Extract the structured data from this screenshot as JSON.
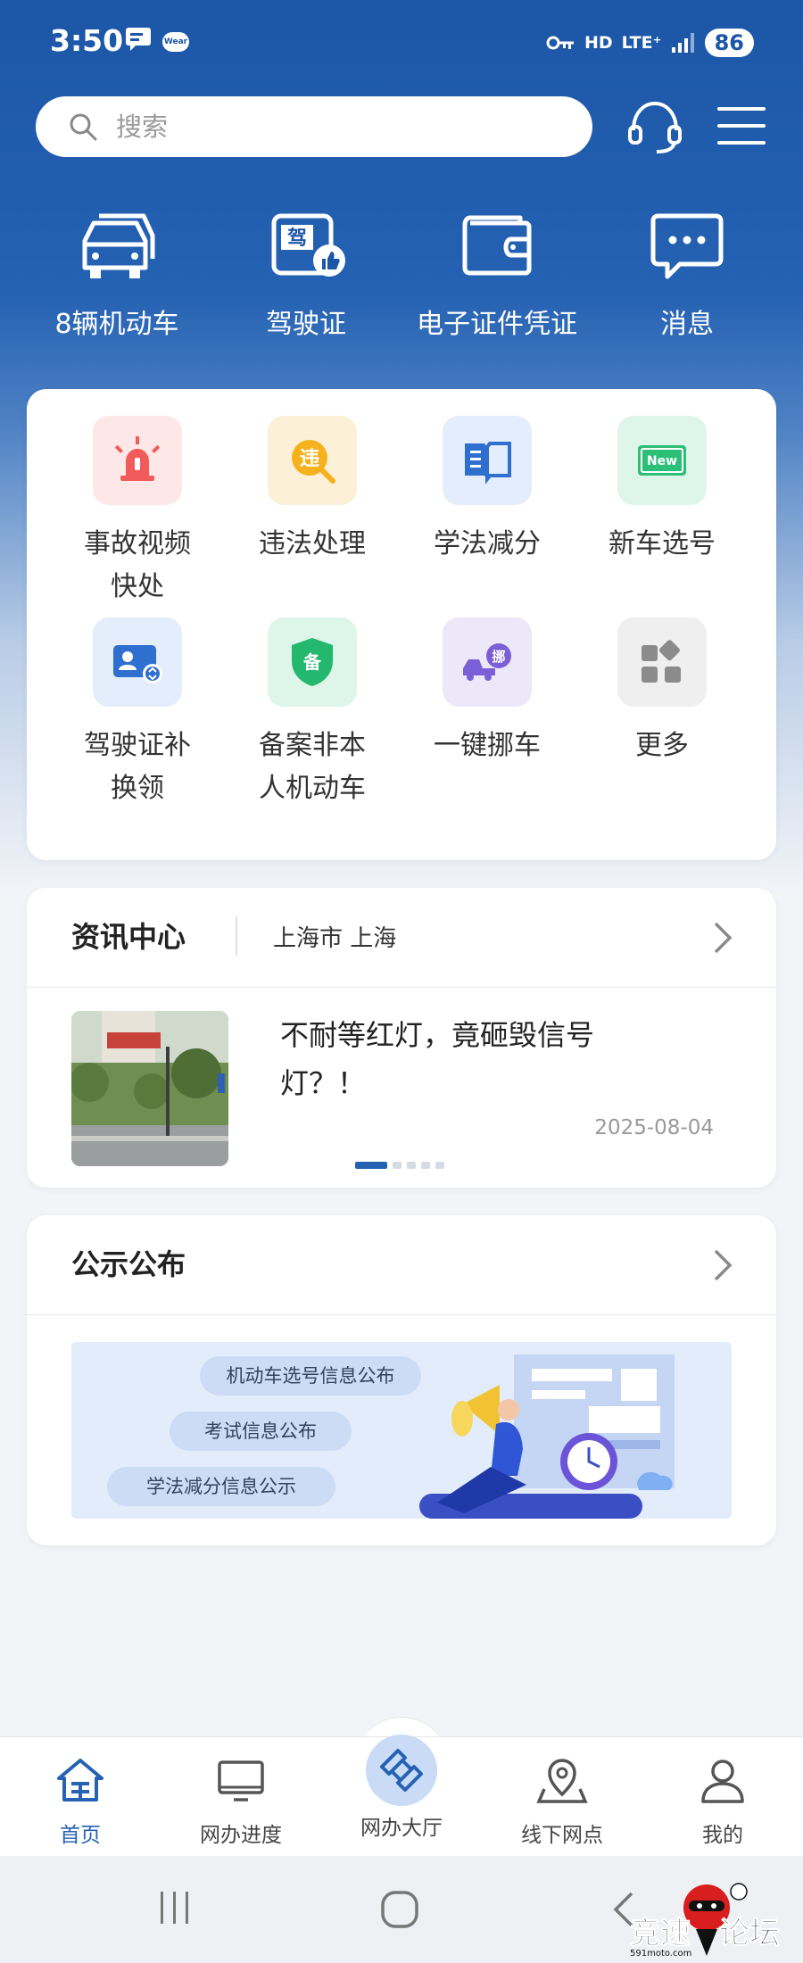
{
  "status_bar": {
    "time": "3:50",
    "wear_label": "Wear",
    "hd": "HD",
    "network": "LTE⁺",
    "battery": "86"
  },
  "search": {
    "placeholder": "搜索"
  },
  "quick_actions": [
    {
      "label": "8辆机动车",
      "icon": "car-icon"
    },
    {
      "label": "驾驶证",
      "icon": "license-icon"
    },
    {
      "label": "电子证件凭证",
      "icon": "wallet-icon"
    },
    {
      "label": "消息",
      "icon": "message-icon"
    }
  ],
  "services": [
    {
      "label": "事故视频\n快处",
      "icon": "siren-icon",
      "bg": "#fde7e7"
    },
    {
      "label": "违法处理",
      "icon": "violation-icon",
      "bg": "#fdf0d8",
      "glyph": "违"
    },
    {
      "label": "学法减分",
      "icon": "book-icon",
      "bg": "#e4edfb"
    },
    {
      "label": "新车选号",
      "icon": "new-plate-icon",
      "bg": "#def5ea",
      "glyph": "New"
    },
    {
      "label": "驾驶证补\n换领",
      "icon": "id-card-icon",
      "bg": "#e4edfb"
    },
    {
      "label": "备案非本\n人机动车",
      "icon": "shield-icon",
      "bg": "#def5ea",
      "glyph": "备"
    },
    {
      "label": "一键挪车",
      "icon": "tow-truck-icon",
      "bg": "#ece8fa",
      "glyph": "挪"
    },
    {
      "label": "更多",
      "icon": "more-grid-icon",
      "bg": "#efefef"
    }
  ],
  "news": {
    "title": "资讯中心",
    "location": "上海市 上海",
    "headline": "不耐等红灯，竟砸毁信号灯？！",
    "date": "2025-08-04",
    "slides_total": 5,
    "slide_active": 1
  },
  "notice": {
    "title": "公示公布",
    "pills": [
      "机动车选号信息公布",
      "考试信息公布",
      "学法减分信息公示"
    ]
  },
  "bottom_nav": [
    {
      "label": "首页",
      "icon": "home-icon",
      "active": true
    },
    {
      "label": "网办进度",
      "icon": "monitor-icon",
      "active": false
    },
    {
      "label": "网办大厅",
      "icon": "hall-icon",
      "active": false
    },
    {
      "label": "线下网点",
      "icon": "location-pin-icon",
      "active": false
    },
    {
      "label": "我的",
      "icon": "user-icon",
      "active": false
    }
  ],
  "watermark": {
    "brand": "竞速论坛",
    "site": "591moto.com"
  },
  "colors": {
    "brand_blue": "#1c56a7",
    "accent": "#2562b3",
    "background": "#f2f4f8"
  }
}
